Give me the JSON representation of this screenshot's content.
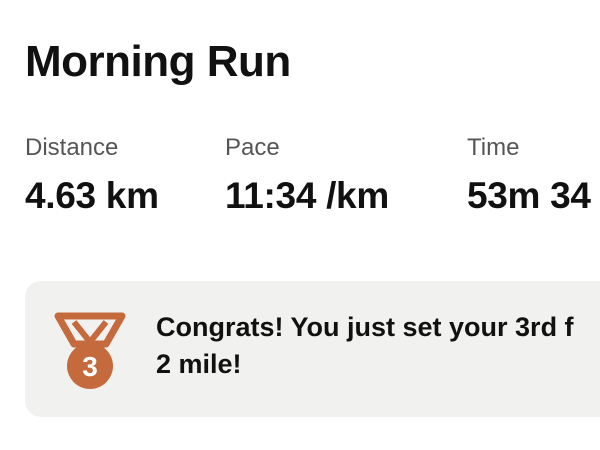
{
  "activity": {
    "title": "Morning Run"
  },
  "stats": {
    "distance": {
      "label": "Distance",
      "value": "4.63 km"
    },
    "pace": {
      "label": "Pace",
      "value": "11:34 /km"
    },
    "time": {
      "label": "Time",
      "value": "53m 34"
    }
  },
  "achievement": {
    "icon": "bronze-medal-icon",
    "rank": "3",
    "message": "Congrats! You just set your 3rd f 2 mile!",
    "message_line1": "Congrats! You just set your 3rd f",
    "message_line2": "2 mile!",
    "medal_color": "#c56a3d",
    "background_color": "#f1f1ef"
  }
}
